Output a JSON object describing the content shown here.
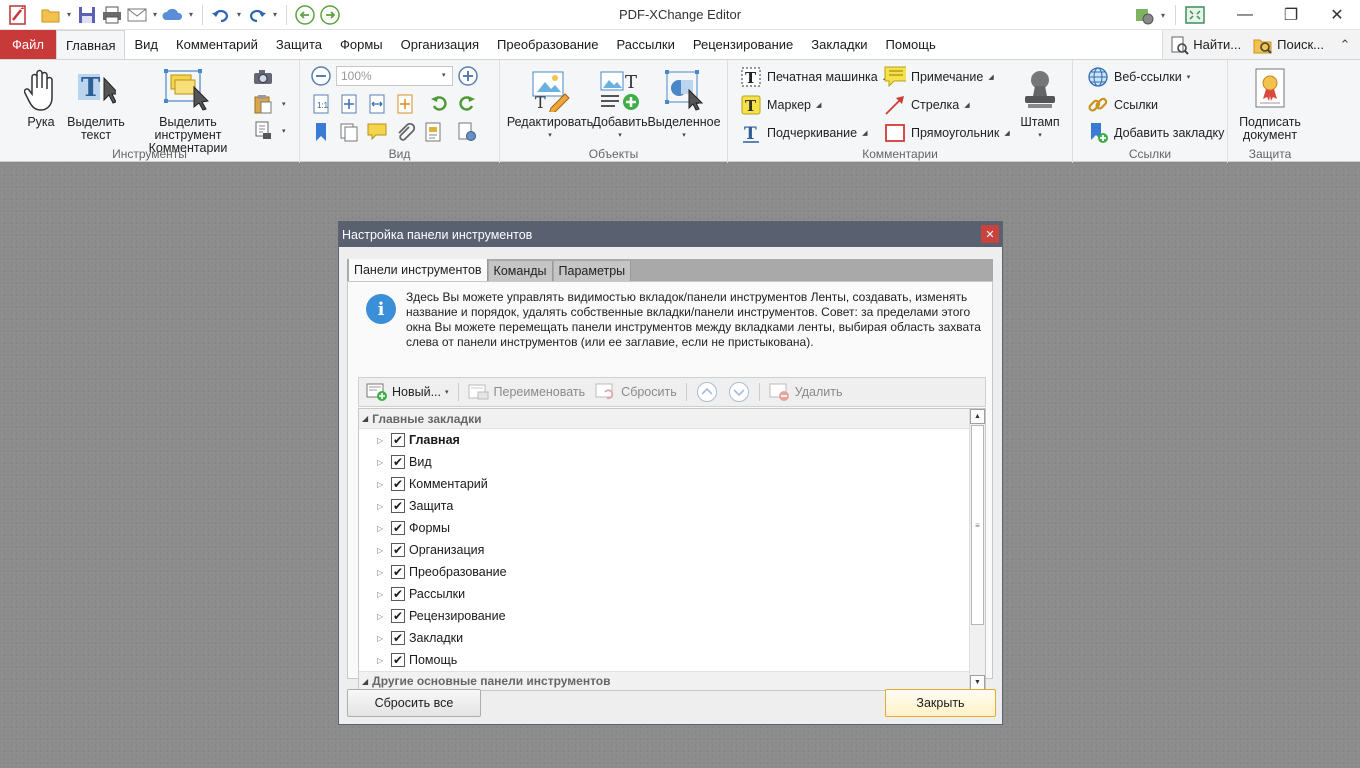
{
  "app": {
    "title": "PDF-XChange Editor"
  },
  "menu": {
    "file": "Файл",
    "tabs": [
      "Главная",
      "Вид",
      "Комментарий",
      "Защита",
      "Формы",
      "Организация",
      "Преобразование",
      "Рассылки",
      "Рецензирование",
      "Закладки",
      "Помощь"
    ],
    "find": "Найти...",
    "search": "Поиск..."
  },
  "ribbon": {
    "tools": {
      "label": "Инструменты",
      "hand": "Рука",
      "select_text": "Выделить текст",
      "select_comments": "Выделить инструмент Комментарии"
    },
    "view": {
      "label": "Вид",
      "zoom": "100%"
    },
    "objects": {
      "label": "Объекты",
      "edit": "Редактировать",
      "add": "Добавить",
      "selected": "Выделенное"
    },
    "comments": {
      "label": "Комментарии",
      "typewriter": "Печатная машинка",
      "highlighter": "Маркер",
      "underline": "Подчеркивание",
      "note": "Примечание",
      "arrow": "Стрелка",
      "rectangle": "Прямоугольник",
      "stamp": "Штамп"
    },
    "links": {
      "label": "Ссылки",
      "web_links": "Веб-ссылки",
      "links": "Ссылки",
      "add_bookmark": "Добавить закладку"
    },
    "protect": {
      "label": "Защита",
      "sign": "Подписать документ"
    }
  },
  "dialog": {
    "title": "Настройка панели инструментов",
    "tabs": [
      "Панели инструментов",
      "Команды",
      "Параметры"
    ],
    "info": "Здесь Вы можете управлять видимостью вкладок/панели инструментов Ленты, создавать,  изменять название и порядок, удалять собственные вкладки/панели инструментов. Совет: за пределами этого окна Вы можете перемещать панели инструментов между вкладками ленты, выбирая область захвата слева от панели инструментов (или ее заглавие, если не пристыкована).",
    "toolbar": {
      "new": "Новый...",
      "rename": "Переименовать",
      "reset": "Сбросить",
      "delete": "Удалить"
    },
    "tree": {
      "group_main": "Главные закладки",
      "items": [
        "Главная",
        "Вид",
        "Комментарий",
        "Защита",
        "Формы",
        "Организация",
        "Преобразование",
        "Рассылки",
        "Рецензирование",
        "Закладки",
        "Помощь"
      ],
      "group_other": "Другие основные панели инструментов"
    },
    "reset_all": "Сбросить все",
    "close": "Закрыть"
  }
}
